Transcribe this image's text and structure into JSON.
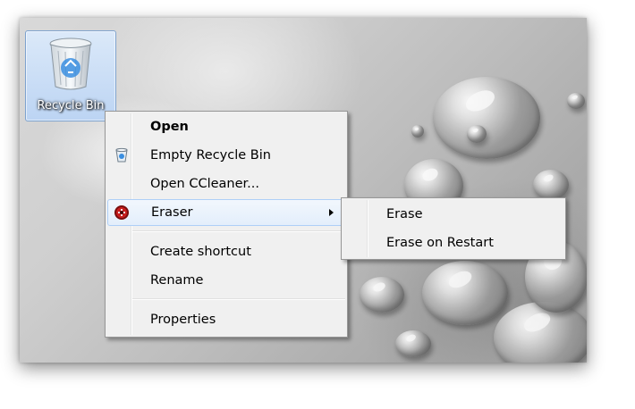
{
  "desktop": {
    "recycle_bin_label": "Recycle Bin"
  },
  "context_menu": {
    "items": [
      {
        "label": "Open",
        "icon": null
      },
      {
        "label": "Empty Recycle Bin",
        "icon": "recycle-bin-icon"
      },
      {
        "label": "Open CCleaner...",
        "icon": null
      },
      {
        "label": "Eraser",
        "icon": "eraser-icon",
        "has_submenu": true
      },
      {
        "label": "Create shortcut",
        "icon": null
      },
      {
        "label": "Rename",
        "icon": null
      },
      {
        "label": "Properties",
        "icon": null
      }
    ]
  },
  "eraser_submenu": {
    "items": [
      {
        "label": "Erase"
      },
      {
        "label": "Erase on Restart"
      }
    ]
  },
  "colors": {
    "menu_background": "#f0f0f0",
    "menu_border": "#979797",
    "hover_border": "#aecff7",
    "selection_blue": "#bcd4f3"
  }
}
